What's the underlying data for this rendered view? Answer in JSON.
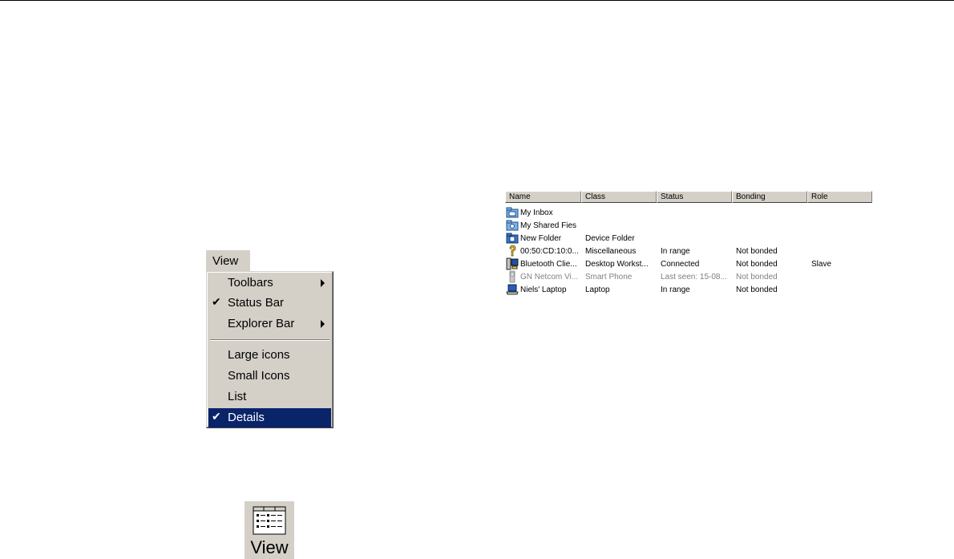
{
  "menu": {
    "title": "View",
    "items": [
      {
        "label": "Toolbars",
        "checked": false,
        "submenu": true
      },
      {
        "label": "Status Bar",
        "checked": true,
        "submenu": false
      },
      {
        "label": "Explorer Bar",
        "checked": false,
        "submenu": true
      },
      {
        "label": "Large icons",
        "checked": false,
        "submenu": false
      },
      {
        "label": "Small Icons",
        "checked": false,
        "submenu": false
      },
      {
        "label": "List",
        "checked": false,
        "submenu": false
      },
      {
        "label": "Details",
        "checked": true,
        "submenu": false,
        "selected": true
      }
    ],
    "check_glyph": "✔",
    "selected_color": "#0a246a"
  },
  "view_button": {
    "label": "View",
    "icon": "details-view-icon"
  },
  "list": {
    "columns": [
      "Name",
      "Class",
      "Status",
      "Bonding",
      "Role"
    ],
    "rows": [
      {
        "icon": "inbox-folder-icon",
        "name": "My Inbox",
        "class": "",
        "status": "",
        "bonding": "",
        "role": ""
      },
      {
        "icon": "shared-folder-icon",
        "name": "My Shared Fies",
        "class": "",
        "status": "",
        "bonding": "",
        "role": ""
      },
      {
        "icon": "device-folder-icon",
        "name": "New Folder",
        "class": "Device Folder",
        "status": "",
        "bonding": "",
        "role": ""
      },
      {
        "icon": "question-mark-icon",
        "name": "00:50:CD:10:0...",
        "class": "Miscellaneous",
        "status": "In range",
        "bonding": "Not bonded",
        "role": ""
      },
      {
        "icon": "desktop-computer-icon",
        "name": "Bluetooth Clie...",
        "class": "Desktop Workst...",
        "status": "Connected",
        "bonding": "Not bonded",
        "role": "Slave"
      },
      {
        "icon": "phone-icon",
        "name": "GN Netcom Vi...",
        "class": "Smart Phone",
        "status": "Last seen: 15-08...",
        "bonding": "Not bonded",
        "role": "",
        "dimmed": true
      },
      {
        "icon": "laptop-icon",
        "name": "Niels' Laptop",
        "class": "Laptop",
        "status": "In range",
        "bonding": "Not bonded",
        "role": ""
      }
    ]
  }
}
